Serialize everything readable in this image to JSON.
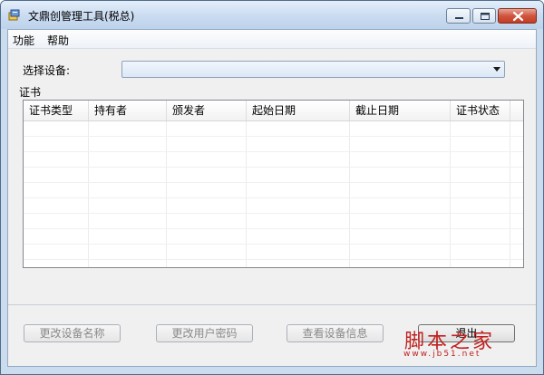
{
  "window": {
    "title": "文鼎创管理工具(税总)"
  },
  "menu": {
    "items": [
      {
        "label": "功能"
      },
      {
        "label": "帮助"
      }
    ]
  },
  "device": {
    "label": "选择设备:",
    "selected": ""
  },
  "certificates": {
    "group_label": "证书",
    "columns": [
      "证书类型",
      "持有者",
      "颁发者",
      "起始日期",
      "截止日期",
      "证书状态"
    ],
    "rows": []
  },
  "buttons": {
    "rename_device": "更改设备名称",
    "change_password": "更改用户密码",
    "view_device_info": "查看设备信息",
    "exit": "退出"
  },
  "watermark": {
    "text": "脚本之家",
    "sub": "www.jb51.net"
  },
  "colors": {
    "title_gradient_top": "#e4eefa",
    "close_button_red": "#c63d22",
    "client_background": "#f0f0f0",
    "watermark_red": "#c0211f"
  }
}
